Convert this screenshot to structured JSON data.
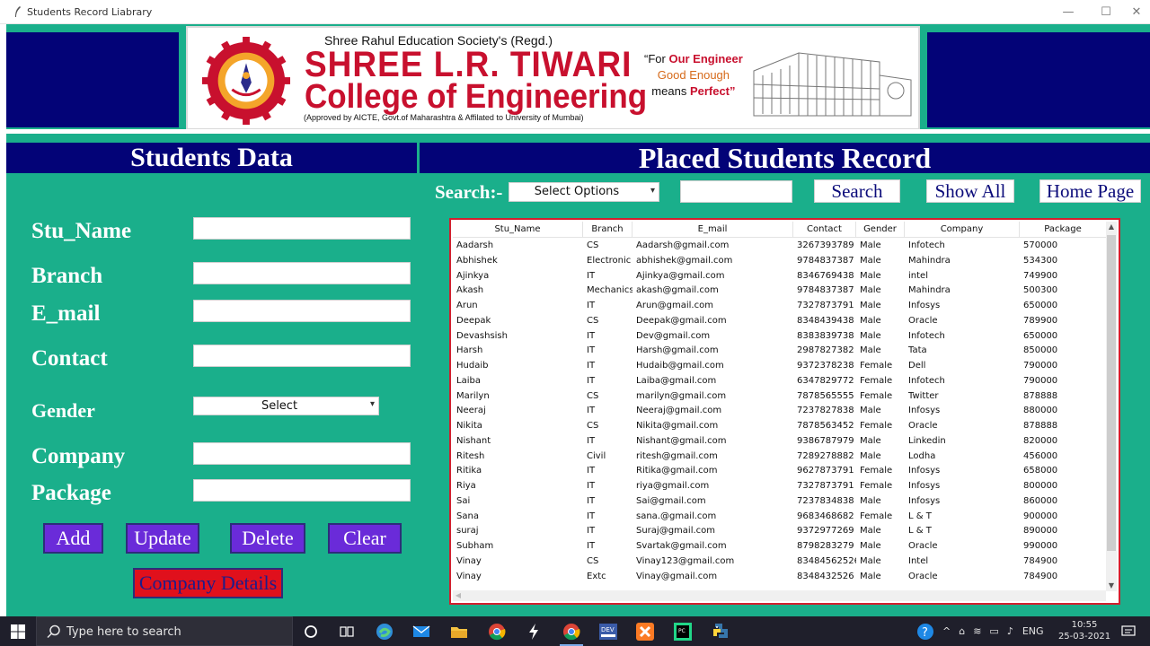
{
  "window": {
    "title": "Students Record Liabrary",
    "controls": {
      "minimize": "—",
      "maximize": "☐",
      "close": "✕"
    }
  },
  "banner": {
    "society": "Shree Rahul Education Society's (Regd.)",
    "college_line1": "SHREE L.R. TIWARI",
    "college_line2": "College of Engineering",
    "approved": "(Approved by AICTE, Govt.of Maharashtra & Affilated to University of Mumbai)",
    "tag_line1_a": "“For ",
    "tag_line1_b": "Our Engineer",
    "tag_line2": "Good Enough",
    "tag_line3_a": "means ",
    "tag_line3_b": "Perfect”",
    "logo_text": "ENGINEERED FOR EXCELLENCE",
    "brand_red": "#c8102e",
    "navy": "#030377"
  },
  "form": {
    "heading": "Students Data",
    "labels": {
      "name": "Stu_Name",
      "branch": "Branch",
      "email": "E_mail",
      "contact": "Contact",
      "gender": "Gender",
      "company": "Company",
      "package": "Package"
    },
    "values": {
      "name": "",
      "branch": "",
      "email": "",
      "contact": "",
      "company": "",
      "package": ""
    },
    "gender_selected": "Select",
    "buttons": {
      "add": "Add",
      "update": "Update",
      "delete": "Delete",
      "clear": "Clear",
      "company_details": "Company Details"
    }
  },
  "records": {
    "heading": "Placed Students Record",
    "search_label": "Search:-",
    "search_option_selected": "Select Options",
    "search_value": "",
    "buttons": {
      "search": "Search",
      "show_all": "Show All",
      "home_page": "Home Page"
    },
    "columns": [
      "Stu_Name",
      "Branch",
      "E_mail",
      "Contact",
      "Gender",
      "Company",
      "Package"
    ],
    "rows": [
      [
        "Aadarsh",
        "CS",
        "Aadarsh@gmail.com",
        "3267393789",
        "Male",
        "Infotech",
        "570000"
      ],
      [
        "Abhishek",
        "Electronic",
        "abhishek@gmail.com",
        "9784837387",
        "Male",
        "Mahindra",
        "534300"
      ],
      [
        "Ajinkya",
        "IT",
        "Ajinkya@gmail.com",
        "8346769438",
        "Male",
        "intel",
        "749900"
      ],
      [
        "Akash",
        "Mechanics",
        "akash@gmail.com",
        "9784837387",
        "Male",
        "Mahindra",
        "500300"
      ],
      [
        "Arun",
        "IT",
        "Arun@gmail.com",
        "7327873791",
        "Male",
        "Infosys",
        "650000"
      ],
      [
        "Deepak",
        "CS",
        "Deepak@gmail.com",
        "8348439438",
        "Male",
        "Oracle",
        "789900"
      ],
      [
        "Devashsish",
        "IT",
        "Dev@gmail.com",
        "8383839738",
        "Male",
        "Infotech",
        "650000"
      ],
      [
        "Harsh",
        "IT",
        "Harsh@gmail.com",
        "2987827382",
        "Male",
        "Tata",
        "850000"
      ],
      [
        "Hudaib",
        "IT",
        "Hudaib@gmail.com",
        "9372378238",
        "Female",
        "Dell",
        "790000"
      ],
      [
        "Laiba",
        "IT",
        "Laiba@gmail.com",
        "6347829772",
        "Female",
        "Infotech",
        "790000"
      ],
      [
        "Marilyn",
        "CS",
        "marilyn@gmail.com",
        "7878565555",
        "Female",
        "Twitter",
        "878888"
      ],
      [
        "Neeraj",
        "IT",
        "Neeraj@gmail.com",
        "7237827838",
        "Male",
        "Infosys",
        "880000"
      ],
      [
        "Nikita",
        "CS",
        "Nikita@gmail.com",
        "7878563452",
        "Female",
        "Oracle",
        "878888"
      ],
      [
        "Nishant",
        "IT",
        "Nishant@gmail.com",
        "9386787979",
        "Male",
        "Linkedin",
        "820000"
      ],
      [
        "Ritesh",
        "Civil",
        "ritesh@gmail.com",
        "7289278882",
        "Male",
        "Lodha",
        "456000"
      ],
      [
        "Ritika",
        "IT",
        "Ritika@gmail.com",
        "9627873791",
        "Female",
        "Infosys",
        "658000"
      ],
      [
        "Riya",
        "IT",
        "riya@gmail.com",
        "7327873791",
        "Female",
        "Infosys",
        "800000"
      ],
      [
        "Sai",
        "IT",
        "Sai@gmail.com",
        "7237834838",
        "Male",
        "Infosys",
        "860000"
      ],
      [
        "Sana",
        "IT",
        "sana.@gmail.com",
        "9683468682",
        "Female",
        "L & T",
        "900000"
      ],
      [
        "suraj",
        "IT",
        "Suraj@gmail.com",
        "9372977269",
        "Male",
        "L & T",
        "890000"
      ],
      [
        "Subham",
        "IT",
        "Svartak@gmail.com",
        "8798283279",
        "Male",
        "Oracle",
        "990000"
      ],
      [
        "Vinay",
        "CS",
        "Vinay123@gmail.com",
        "83484562526",
        "Male",
        "Intel",
        "784900"
      ],
      [
        "Vinay",
        "Extc",
        "Vinay@gmail.com",
        "8348432526",
        "Male",
        "Oracle",
        "784900"
      ]
    ]
  },
  "taskbar": {
    "search_placeholder": "Type here to search",
    "icons": [
      "windows-start-icon",
      "cortana-icon",
      "task-view-icon",
      "edge-icon",
      "mail-icon",
      "file-explorer-icon",
      "chrome-icon",
      "bolt-app-icon",
      "chrome-profile-icon",
      "dev-app-icon",
      "xampp-icon",
      "pycharm-icon",
      "python-icon"
    ],
    "tray_lang": "ENG",
    "time": "10:55",
    "date": "25-03-2021"
  }
}
